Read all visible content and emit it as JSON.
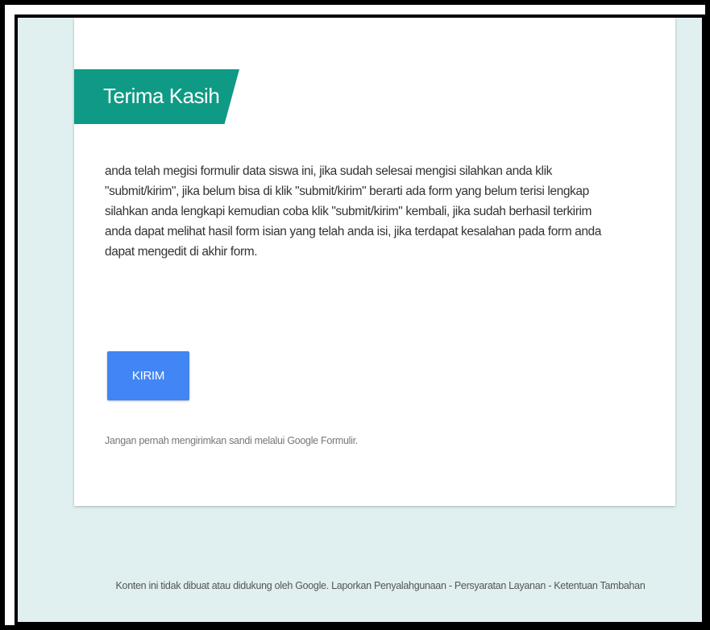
{
  "form": {
    "title": "Terima Kasih",
    "description": "anda telah megisi formulir data siswa ini, jika sudah selesai mengisi silahkan anda klik \"submit/kirim\", jika belum bisa di klik \"submit/kirim\" berarti ada form yang belum terisi lengkap silahkan anda lengkapi kemudian coba klik \"submit/kirim\" kembali, jika sudah berhasil terkirim anda dapat melihat hasil form isian yang telah anda isi, jika terdapat kesalahan pada form anda dapat mengedit di akhir form.",
    "submit_label": "KIRIM",
    "password_warning": "Jangan pernah mengirimkan sandi melalui Google Formulir."
  },
  "footer": {
    "disclaimer": "Konten ini tidak dibuat atau didukung oleh Google.",
    "report_abuse": "Laporkan Penyalahgunaan",
    "separator": "-",
    "terms_of_service": "Persyaratan Layanan",
    "additional_terms": "Ketentuan Tambahan"
  },
  "colors": {
    "page_background": "#e0efef",
    "title_banner": "#0e9a84",
    "submit_button": "#4285f4",
    "frame_border": "#000000"
  }
}
